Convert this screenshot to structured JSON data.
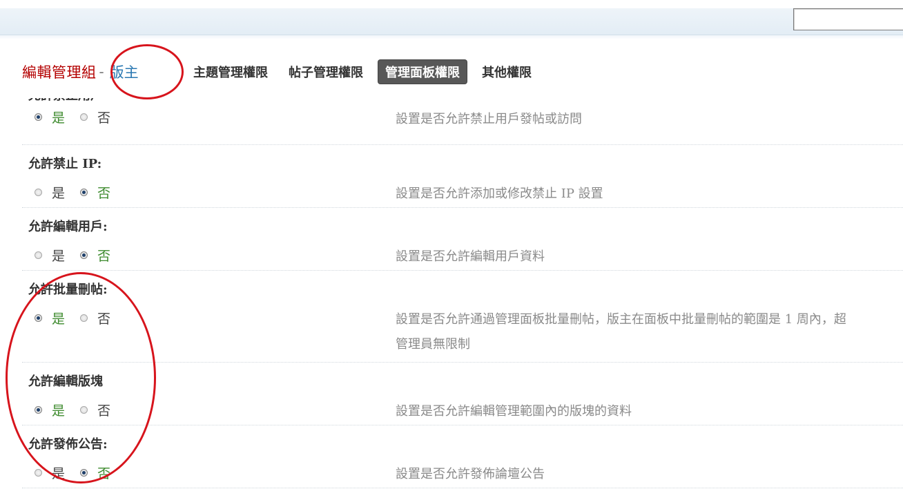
{
  "header": {
    "title": "編輯管理組",
    "separator": "-",
    "role": "版主"
  },
  "tabs": [
    {
      "label": "主題管理權限",
      "active": false
    },
    {
      "label": "帖子管理權限",
      "active": false
    },
    {
      "label": "管理面板權限",
      "active": true
    },
    {
      "label": "其他權限",
      "active": false
    }
  ],
  "options": {
    "yes": "是",
    "no": "否"
  },
  "settings": [
    {
      "label": "允許禁止用戶",
      "value": "yes",
      "description": "設置是否允許禁止用戶發帖或訪問"
    },
    {
      "label": "允許禁止 IP:",
      "value": "no",
      "description": "設置是否允許添加或修改禁止 IP 設置"
    },
    {
      "label": "允許編輯用戶:",
      "value": "no",
      "description": "設置是否允許編輯用戶資料"
    },
    {
      "label": "允許批量刪帖:",
      "value": "yes",
      "description": "設置是否允許通過管理面板批量刪帖，版主在面板中批量刪帖的範圍是 1 周內，超",
      "description2": "管理員無限制"
    },
    {
      "label": "允許編輯版塊",
      "value": "yes",
      "description": "設置是否允許編輯管理範圍內的版塊的資料"
    },
    {
      "label": "允許發佈公告:",
      "value": "no",
      "description": "設置是否允許發佈論壇公告"
    }
  ],
  "colors": {
    "annotation": "#d7141c",
    "title": "#b40000",
    "role": "#2a78b2",
    "selected": "#3d8a2d"
  }
}
